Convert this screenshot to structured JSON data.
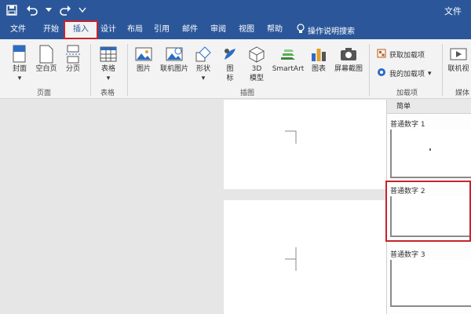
{
  "window": {
    "title_right": "文件"
  },
  "qat": {
    "save_icon": "save-icon",
    "undo_icon": "undo-icon",
    "redo_icon": "redo-icon",
    "more_icon": "customize-icon"
  },
  "tabs": [
    {
      "label": "文件"
    },
    {
      "label": "开始"
    },
    {
      "label": "插入"
    },
    {
      "label": "设计"
    },
    {
      "label": "布局"
    },
    {
      "label": "引用"
    },
    {
      "label": "邮件"
    },
    {
      "label": "审阅"
    },
    {
      "label": "视图"
    },
    {
      "label": "帮助"
    }
  ],
  "tell_me": "操作说明搜索",
  "ribbon": {
    "pages": {
      "cover": "封面",
      "blank": "空白页",
      "break": "分页",
      "group": "页面"
    },
    "tables": {
      "table": "表格",
      "group": "表格"
    },
    "illustrations": {
      "pictures": "图片",
      "online": "联机图片",
      "shapes": "形状",
      "icons_line1": "图",
      "icons_line2": "标",
      "model_line1": "3D",
      "model_line2": "模型",
      "smartart": "SmartArt",
      "chart": "图表",
      "screenshot": "屏幕截图",
      "group": "插图"
    },
    "addins": {
      "get": "获取加载项",
      "mine": "我的加载项",
      "group": "加载项"
    },
    "media": {
      "online_video": "联机视",
      "group": "媒体"
    }
  },
  "gallery": {
    "header": "简单",
    "items": [
      {
        "label": "普通数字 1"
      },
      {
        "label": "普通数字 2"
      },
      {
        "label": "普通数字 3"
      }
    ]
  },
  "colors": {
    "accent": "#2b579a",
    "highlight": "#c8232c"
  }
}
